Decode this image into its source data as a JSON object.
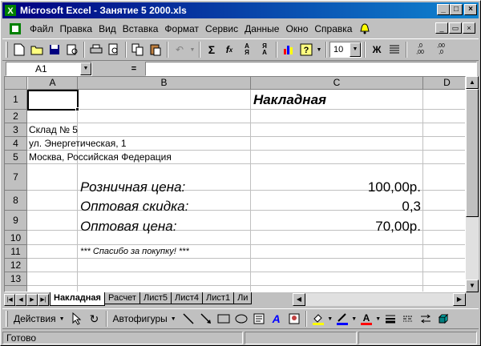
{
  "window": {
    "title": "Microsoft Excel - Занятие 5 2000.xls",
    "min_label": "_",
    "max_label": "□",
    "close_label": "×"
  },
  "menu": [
    {
      "label": "Файл"
    },
    {
      "label": "Правка"
    },
    {
      "label": "Вид"
    },
    {
      "label": "Вставка"
    },
    {
      "label": "Формат"
    },
    {
      "label": "Сервис"
    },
    {
      "label": "Данные"
    },
    {
      "label": "Окно"
    },
    {
      "label": "Справка"
    }
  ],
  "toolbar": {
    "font_size": "10",
    "bold_label": "Ж"
  },
  "formula_bar": {
    "name_box": "A1",
    "equals": "=",
    "content": ""
  },
  "columns": [
    "A",
    "B",
    "C",
    "D"
  ],
  "rows": [
    "1",
    "2",
    "3",
    "4",
    "5",
    "7",
    "8",
    "9",
    "10",
    "11",
    "12",
    "13"
  ],
  "cells": {
    "c1": "Накладная",
    "a3": "Склад № 5",
    "a4": "ул. Энергетическая, 1",
    "a5": "Москва, Российская Федерация",
    "b7": "Розничная цена:",
    "c7": "100,00р.",
    "b8": "Оптовая скидка:",
    "c8": "0,3",
    "b9": "Оптовая цена:",
    "c9": "70,00р.",
    "b11": "*** Спасибо за покупку! ***"
  },
  "sheet_tabs": [
    "Накладная",
    "Расчет",
    "Лист5",
    "Лист4",
    "Лист1",
    "Ли"
  ],
  "drawing_toolbar": {
    "actions_label": "Действия",
    "autoshapes_label": "Автофигуры"
  },
  "status": {
    "text": "Готово"
  },
  "colors": {
    "title_start": "#000080",
    "title_end": "#1084d0",
    "chrome": "#c0c0c0",
    "fill_color": "#ffff00",
    "line_color": "#0000ff",
    "font_color": "#ff0000"
  }
}
